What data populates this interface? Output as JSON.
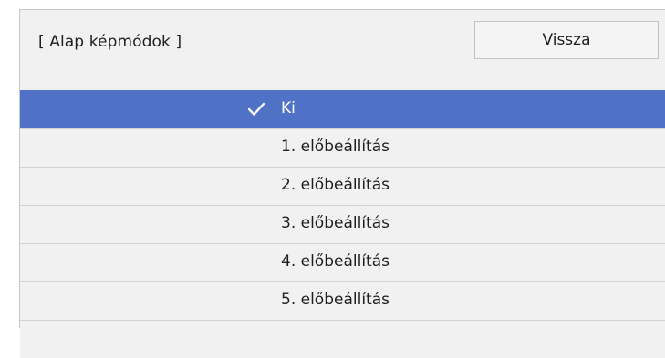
{
  "header": {
    "title": "[ Alap képmódok ]",
    "back_label": "Vissza"
  },
  "list": {
    "items": [
      {
        "label": "Ki",
        "selected": true,
        "icon": "check-icon"
      },
      {
        "label": "1. előbeállítás",
        "selected": false
      },
      {
        "label": "2. előbeállítás",
        "selected": false
      },
      {
        "label": "3. előbeállítás",
        "selected": false
      },
      {
        "label": "4. előbeállítás",
        "selected": false
      },
      {
        "label": "5. előbeállítás",
        "selected": false
      }
    ]
  },
  "colors": {
    "selected_bg": "#4f72c7",
    "panel_bg": "#f1f1f1",
    "divider": "#d2d2d2"
  }
}
